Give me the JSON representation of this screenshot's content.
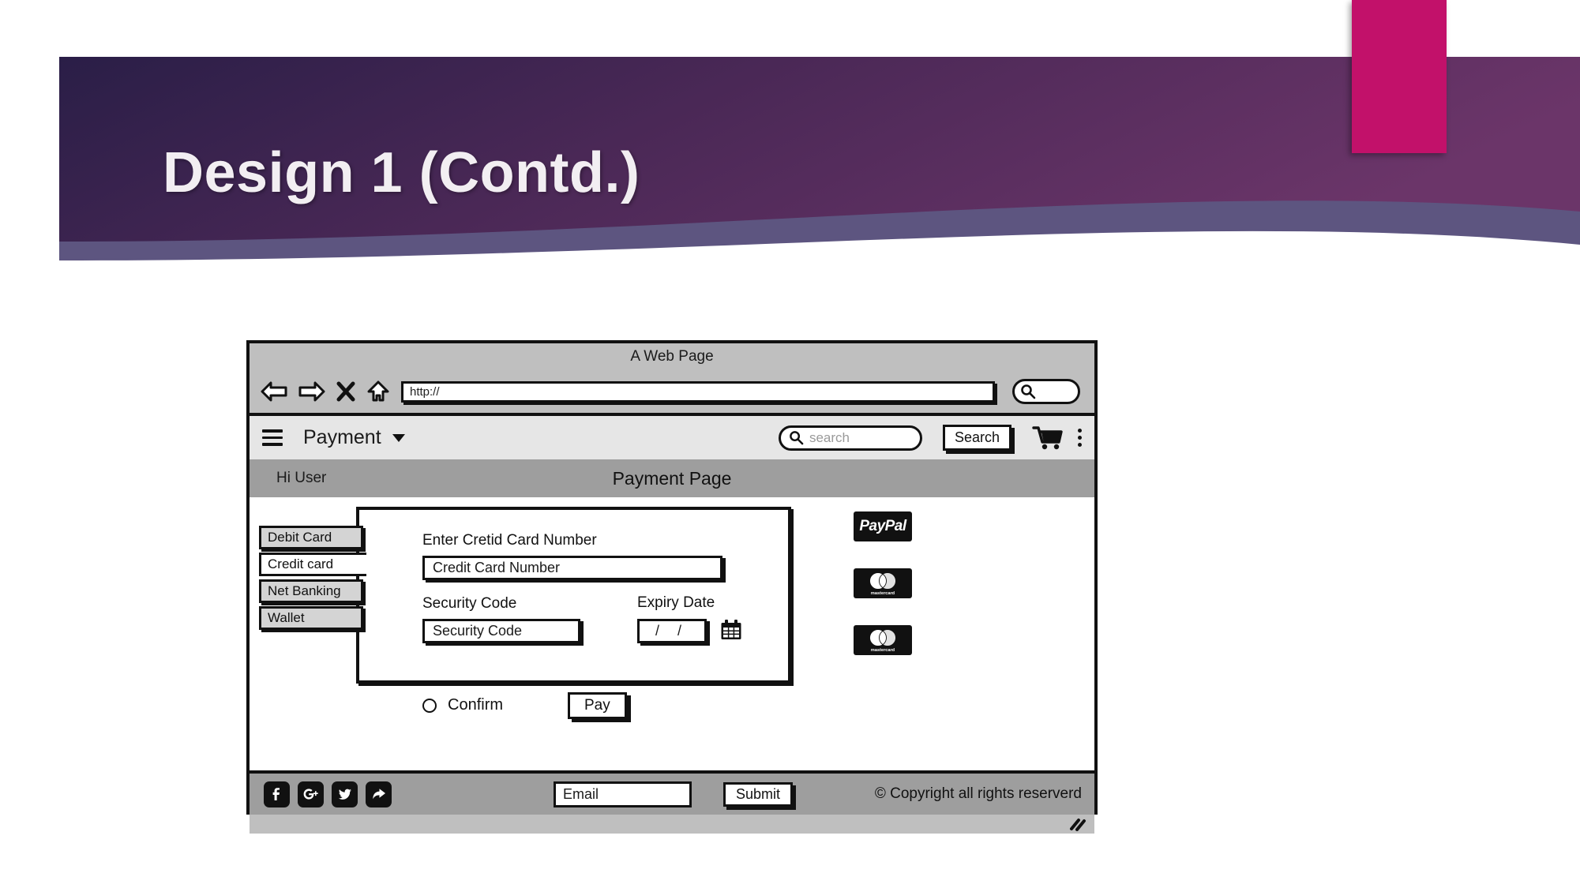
{
  "slide": {
    "title": "Design 1 (Contd.)",
    "accent_color": "#C2116A",
    "banner_gradient_from": "#2A1E47",
    "banner_gradient_to": "#6B3569",
    "banner_wedge_color": "#5D5580",
    "background": "#FFFFFF"
  },
  "browser": {
    "window_title": "A Web Page",
    "toolbar": {
      "back_icon": "back-arrow-icon",
      "forward_icon": "forward-arrow-icon",
      "stop_icon": "stop-x-icon",
      "home_icon": "home-icon",
      "url_value": "http://",
      "url_placeholder": "http://",
      "search_icon": "magnifier-icon"
    }
  },
  "appbar": {
    "menu_icon": "hamburger-menu-icon",
    "brand": "Payment",
    "caret_icon": "chevron-down-icon",
    "search_placeholder": "search",
    "search_icon": "magnifier-icon",
    "search_button": "Search",
    "cart_icon": "shopping-cart-icon",
    "overflow_icon": "kebab-menu-icon"
  },
  "pagehead": {
    "greeting": "Hi User",
    "title": "Payment Page"
  },
  "sidebar": {
    "tabs": [
      {
        "label": "Debit Card",
        "active": false
      },
      {
        "label": "Credit card",
        "active": true
      },
      {
        "label": "Net Banking",
        "active": false
      },
      {
        "label": "Wallet",
        "active": false
      }
    ]
  },
  "form": {
    "card_number_label": "Enter Cretid Card Number",
    "card_number_placeholder": "Credit Card Number",
    "security_code_label": "Security Code",
    "security_code_placeholder": "Security Code",
    "expiry_label": "Expiry Date",
    "expiry_value": "/  /",
    "calendar_icon": "calendar-icon"
  },
  "logos": [
    {
      "name": "paypal-logo",
      "text": "PayPal"
    },
    {
      "name": "mastercard-logo",
      "text": "mastercard"
    },
    {
      "name": "mastercard-logo",
      "text": "mastercard"
    }
  ],
  "actions": {
    "confirm_label": "Confirm",
    "pay_label": "Pay"
  },
  "footer": {
    "social": [
      {
        "name": "facebook-icon"
      },
      {
        "name": "google-plus-icon"
      },
      {
        "name": "twitter-icon"
      },
      {
        "name": "share-icon"
      }
    ],
    "email_placeholder": "Email",
    "submit_label": "Submit",
    "copyright": "© Copyright all rights reserverd",
    "resize_icon": "resize-grip-icon"
  }
}
